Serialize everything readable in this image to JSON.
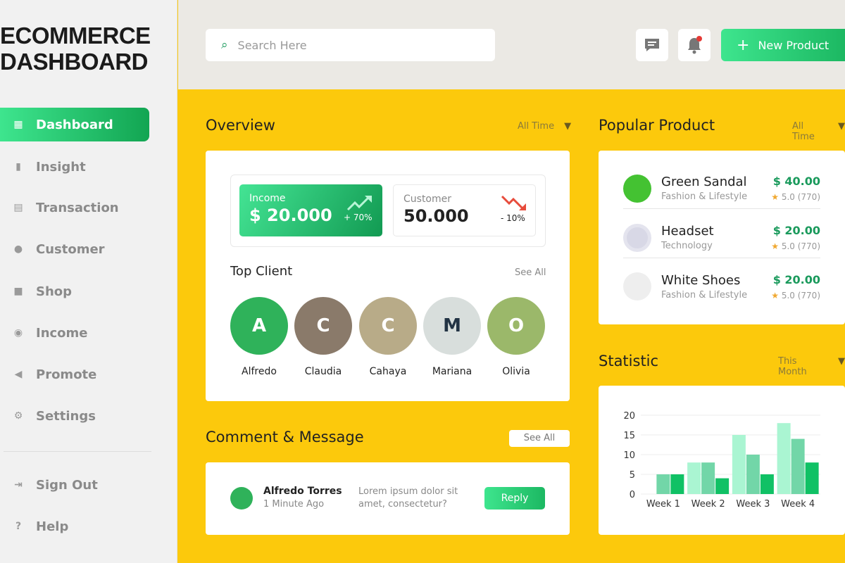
{
  "brand": {
    "line1": "ECOMMERCE",
    "line2": "DASHBOARD"
  },
  "sidebar": {
    "items": [
      {
        "label": "Dashboard",
        "icon": "grid-icon",
        "active": true
      },
      {
        "label": "Insight",
        "icon": "bar-chart-icon"
      },
      {
        "label": "Transaction",
        "icon": "receipt-icon"
      },
      {
        "label": "Customer",
        "icon": "users-icon"
      },
      {
        "label": "Shop",
        "icon": "shopping-bag-icon"
      },
      {
        "label": "Income",
        "icon": "coins-icon"
      },
      {
        "label": "Promote",
        "icon": "megaphone-icon"
      },
      {
        "label": "Settings",
        "icon": "gear-icon"
      }
    ],
    "signout": "Sign Out",
    "help": "Help"
  },
  "header": {
    "search_placeholder": "Search Here",
    "new_product": "New Product",
    "notification_badge_color": "#e53935"
  },
  "overview": {
    "title": "Overview",
    "filter": "All Time",
    "income": {
      "label": "Income",
      "value": "$ 20.000",
      "change": "+ 70%"
    },
    "customer": {
      "label": "Customer",
      "value": "50.000",
      "change": "- 10%"
    },
    "top_client_title": "Top Client",
    "see_all": "See All",
    "clients": [
      "Alfredo",
      "Claudia",
      "Cahaya",
      "Mariana",
      "Olivia"
    ]
  },
  "comments": {
    "title": "Comment & Message",
    "see_all": "See All",
    "items": [
      {
        "name": "Alfredo Torres",
        "time": "1 Minute Ago",
        "message": "Lorem ipsum dolor sit amet, consectetur?",
        "reply": "Reply"
      }
    ]
  },
  "popular": {
    "title": "Popular Product",
    "filter": "All Time",
    "items": [
      {
        "name": "Green Sandal",
        "category": "Fashion & Lifestyle",
        "price": "$ 40.00",
        "rating": "5.0 (770)"
      },
      {
        "name": "Headset",
        "category": "Technology",
        "price": "$ 20.00",
        "rating": "5.0 (770)"
      },
      {
        "name": "White Shoes",
        "category": "Fashion & Lifestyle",
        "price": "$ 20.00",
        "rating": "5.0 (770)"
      }
    ]
  },
  "statistic": {
    "title": "Statistic",
    "filter": "This Month"
  },
  "chart_data": {
    "type": "bar",
    "categories": [
      "Week 1",
      "Week 2",
      "Week 3",
      "Week 4"
    ],
    "series": [
      {
        "values": [
          0,
          8,
          15,
          18
        ],
        "color": "#aaf5d2"
      },
      {
        "values": [
          5,
          8,
          10,
          14
        ],
        "color": "#72d6a8"
      },
      {
        "values": [
          5,
          4,
          5,
          8
        ],
        "color": "#10c165"
      }
    ],
    "yticks": [
      0,
      5,
      10,
      15,
      20
    ],
    "ylim": [
      0,
      20
    ],
    "grid": true
  },
  "colors": {
    "accent": "#1cb862",
    "background": "#fcc90c"
  }
}
